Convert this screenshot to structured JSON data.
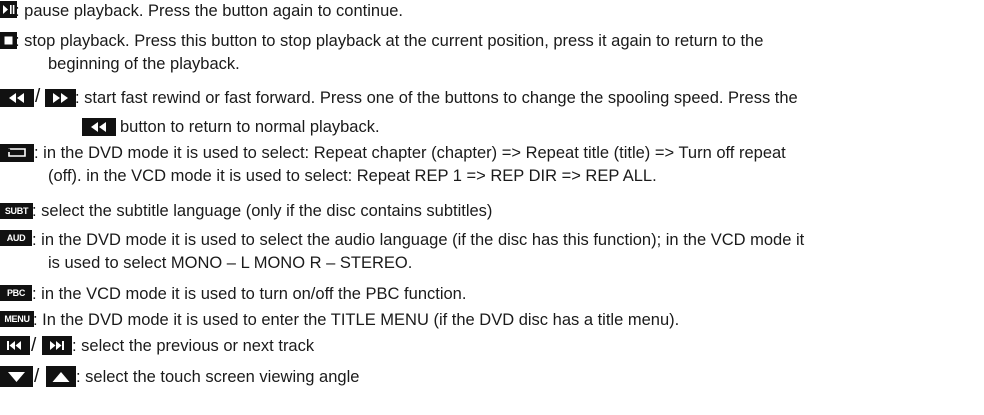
{
  "entries": [
    {
      "id": "pause",
      "icon": "play-pause-icon",
      "lines": [
        ": pause playback. Press the button again to continue."
      ]
    },
    {
      "id": "stop",
      "icon": "stop-icon",
      "lines": [
        ": stop playback. Press this button to stop playback at the current position, press it again to return to the",
        "beginning of the playback."
      ]
    },
    {
      "id": "spool",
      "icons": [
        "fast-rewind-icon",
        "fast-forward-icon",
        "fast-rewind-icon"
      ],
      "lines": [
        ": start fast rewind or fast forward. Press one of the buttons to change the spooling speed. Press the",
        "button to return to normal playback."
      ]
    },
    {
      "id": "repeat",
      "icon": "repeat-icon",
      "lines": [
        ": in the DVD mode it is used to select: Repeat chapter (chapter) => Repeat title (title) => Turn off repeat",
        "(off). in the VCD mode it is used to select: Repeat REP 1 => REP DIR => REP ALL."
      ]
    },
    {
      "id": "subtitle",
      "icon_text": "SUBT",
      "lines": [
        ": select the subtitle language (only if the disc contains subtitles)"
      ]
    },
    {
      "id": "audio",
      "icon_text": "AUD",
      "lines": [
        ": in the DVD mode it is used to select the audio language (if the disc has this function); in the VCD mode it",
        "is used to select MONO – L MONO R – STEREO."
      ]
    },
    {
      "id": "pbc",
      "icon_text": "PBC",
      "lines": [
        ": in the VCD mode it is used to turn on/off the PBC function."
      ]
    },
    {
      "id": "menu",
      "icon_text": "MENU",
      "lines": [
        ": In the DVD mode it is used to enter the TITLE MENU (if the DVD disc has a title menu)."
      ]
    },
    {
      "id": "track",
      "icons": [
        "previous-track-icon",
        "next-track-icon"
      ],
      "lines": [
        ": select the previous or next track"
      ]
    },
    {
      "id": "angle",
      "icons": [
        "triangle-down-icon",
        "triangle-up-icon"
      ],
      "lines": [
        ": select the touch screen viewing angle"
      ]
    }
  ],
  "separator": "/"
}
